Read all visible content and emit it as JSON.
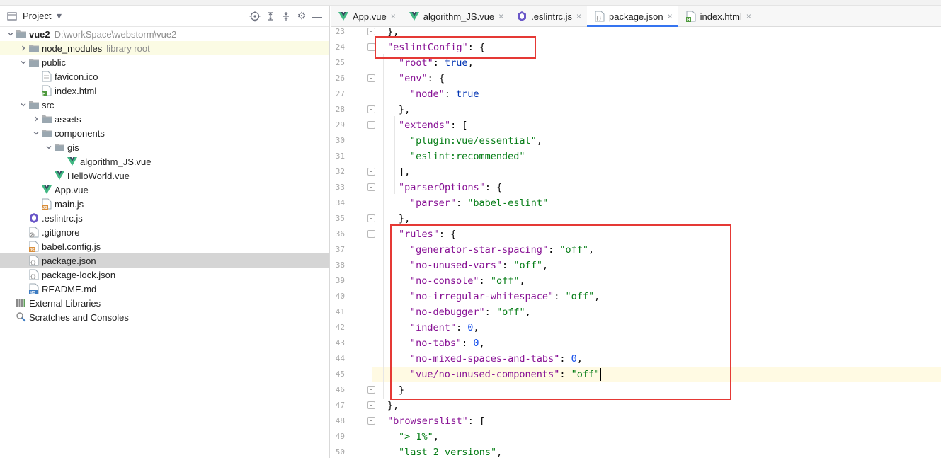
{
  "project_panel": {
    "title": "Project",
    "tree": [
      {
        "indent": 0,
        "arrow": "down",
        "icon": "folder-icon",
        "label": "vue2",
        "bold": true,
        "muted": "D:\\workSpace\\webstorm\\vue2"
      },
      {
        "indent": 1,
        "arrow": "right",
        "icon": "folder-icon",
        "label": "node_modules",
        "muted": "library root",
        "hl": true
      },
      {
        "indent": 1,
        "arrow": "down",
        "icon": "folder-icon",
        "label": "public"
      },
      {
        "indent": 2,
        "arrow": "",
        "icon": "ico-file-icon",
        "label": "favicon.ico"
      },
      {
        "indent": 2,
        "arrow": "",
        "icon": "html-file-icon",
        "label": "index.html"
      },
      {
        "indent": 1,
        "arrow": "down",
        "icon": "folder-icon",
        "label": "src"
      },
      {
        "indent": 2,
        "arrow": "right",
        "icon": "folder-icon",
        "label": "assets"
      },
      {
        "indent": 2,
        "arrow": "down",
        "icon": "folder-icon",
        "label": "components"
      },
      {
        "indent": 3,
        "arrow": "down",
        "icon": "folder-icon",
        "label": "gis"
      },
      {
        "indent": 4,
        "arrow": "",
        "icon": "vue-file-icon",
        "label": "algorithm_JS.vue"
      },
      {
        "indent": 3,
        "arrow": "",
        "icon": "vue-file-icon",
        "label": "HelloWorld.vue"
      },
      {
        "indent": 2,
        "arrow": "",
        "icon": "vue-file-icon",
        "label": "App.vue"
      },
      {
        "indent": 2,
        "arrow": "",
        "icon": "js-file-icon",
        "label": "main.js"
      },
      {
        "indent": 1,
        "arrow": "",
        "icon": "eslint-file-icon",
        "label": ".eslintrc.js"
      },
      {
        "indent": 1,
        "arrow": "",
        "icon": "gitignore-file-icon",
        "label": ".gitignore"
      },
      {
        "indent": 1,
        "arrow": "",
        "icon": "js-file-icon",
        "label": "babel.config.js"
      },
      {
        "indent": 1,
        "arrow": "",
        "icon": "json-file-icon",
        "label": "package.json",
        "selected": true
      },
      {
        "indent": 1,
        "arrow": "",
        "icon": "json-file-icon",
        "label": "package-lock.json"
      },
      {
        "indent": 1,
        "arrow": "",
        "icon": "md-file-icon",
        "label": "README.md"
      },
      {
        "indent": 0,
        "arrow": "",
        "icon": "libraries-icon",
        "label": "External Libraries"
      },
      {
        "indent": 0,
        "arrow": "",
        "icon": "scratches-icon",
        "label": "Scratches and Consoles"
      }
    ]
  },
  "tabs": [
    {
      "label": "App.vue",
      "icon": "vue-file-icon"
    },
    {
      "label": "algorithm_JS.vue",
      "icon": "vue-file-icon"
    },
    {
      "label": ".eslintrc.js",
      "icon": "eslint-file-icon"
    },
    {
      "label": "package.json",
      "icon": "json-file-icon",
      "active": true
    },
    {
      "label": "index.html",
      "icon": "html-file-icon"
    }
  ],
  "editor": {
    "current_line": 45,
    "lines": [
      {
        "n": 23,
        "ind": 1,
        "parts": [
          [
            "p",
            "},"
          ]
        ],
        "fold": true
      },
      {
        "n": 24,
        "ind": 1,
        "parts": [
          [
            "k",
            "\"eslintConfig\""
          ],
          [
            "p",
            ": {"
          ]
        ],
        "fold": true
      },
      {
        "n": 25,
        "ind": 2,
        "parts": [
          [
            "k",
            "\"root\""
          ],
          [
            "p",
            ": "
          ],
          [
            "w",
            "true"
          ],
          [
            "p",
            ","
          ]
        ]
      },
      {
        "n": 26,
        "ind": 2,
        "parts": [
          [
            "k",
            "\"env\""
          ],
          [
            "p",
            ": {"
          ]
        ],
        "fold": true
      },
      {
        "n": 27,
        "ind": 3,
        "parts": [
          [
            "k",
            "\"node\""
          ],
          [
            "p",
            ": "
          ],
          [
            "w",
            "true"
          ]
        ]
      },
      {
        "n": 28,
        "ind": 2,
        "parts": [
          [
            "p",
            "},"
          ]
        ],
        "fold": true
      },
      {
        "n": 29,
        "ind": 2,
        "parts": [
          [
            "k",
            "\"extends\""
          ],
          [
            "p",
            ": ["
          ]
        ],
        "fold": true
      },
      {
        "n": 30,
        "ind": 3,
        "parts": [
          [
            "s",
            "\"plugin:vue/essential\""
          ],
          [
            "p",
            ","
          ]
        ]
      },
      {
        "n": 31,
        "ind": 3,
        "parts": [
          [
            "s",
            "\"eslint:recommended\""
          ]
        ]
      },
      {
        "n": 32,
        "ind": 2,
        "parts": [
          [
            "p",
            "],"
          ]
        ],
        "fold": true
      },
      {
        "n": 33,
        "ind": 2,
        "parts": [
          [
            "k",
            "\"parserOptions\""
          ],
          [
            "p",
            ": {"
          ]
        ],
        "fold": true
      },
      {
        "n": 34,
        "ind": 3,
        "parts": [
          [
            "k",
            "\"parser\""
          ],
          [
            "p",
            ": "
          ],
          [
            "s",
            "\"babel-eslint\""
          ]
        ]
      },
      {
        "n": 35,
        "ind": 2,
        "parts": [
          [
            "p",
            "},"
          ]
        ],
        "fold": true
      },
      {
        "n": 36,
        "ind": 2,
        "parts": [
          [
            "k",
            "\"rules\""
          ],
          [
            "p",
            ": {"
          ]
        ],
        "fold": true
      },
      {
        "n": 37,
        "ind": 3,
        "parts": [
          [
            "k",
            "\"generator-star-spacing\""
          ],
          [
            "p",
            ": "
          ],
          [
            "s",
            "\"off\""
          ],
          [
            "p",
            ","
          ]
        ]
      },
      {
        "n": 38,
        "ind": 3,
        "parts": [
          [
            "k",
            "\"no-unused-vars\""
          ],
          [
            "p",
            ": "
          ],
          [
            "s",
            "\"off\""
          ],
          [
            "p",
            ","
          ]
        ]
      },
      {
        "n": 39,
        "ind": 3,
        "parts": [
          [
            "k",
            "\"no-console\""
          ],
          [
            "p",
            ": "
          ],
          [
            "s",
            "\"off\""
          ],
          [
            "p",
            ","
          ]
        ]
      },
      {
        "n": 40,
        "ind": 3,
        "parts": [
          [
            "k",
            "\"no-irregular-whitespace\""
          ],
          [
            "p",
            ": "
          ],
          [
            "s",
            "\"off\""
          ],
          [
            "p",
            ","
          ]
        ]
      },
      {
        "n": 41,
        "ind": 3,
        "parts": [
          [
            "k",
            "\"no-debugger\""
          ],
          [
            "p",
            ": "
          ],
          [
            "s",
            "\"off\""
          ],
          [
            "p",
            ","
          ]
        ]
      },
      {
        "n": 42,
        "ind": 3,
        "parts": [
          [
            "k",
            "\"indent\""
          ],
          [
            "p",
            ": "
          ],
          [
            "n",
            "0"
          ],
          [
            "p",
            ","
          ]
        ]
      },
      {
        "n": 43,
        "ind": 3,
        "parts": [
          [
            "k",
            "\"no-tabs\""
          ],
          [
            "p",
            ": "
          ],
          [
            "n",
            "0"
          ],
          [
            "p",
            ","
          ]
        ]
      },
      {
        "n": 44,
        "ind": 3,
        "parts": [
          [
            "k",
            "\"no-mixed-spaces-and-tabs\""
          ],
          [
            "p",
            ": "
          ],
          [
            "n",
            "0"
          ],
          [
            "p",
            ","
          ]
        ]
      },
      {
        "n": 45,
        "ind": 3,
        "parts": [
          [
            "k",
            "\"vue/no-unused-components\""
          ],
          [
            "p",
            ": "
          ],
          [
            "s",
            "\"off\""
          ]
        ],
        "caret": true
      },
      {
        "n": 46,
        "ind": 2,
        "parts": [
          [
            "p",
            "}"
          ]
        ],
        "fold": true
      },
      {
        "n": 47,
        "ind": 1,
        "parts": [
          [
            "p",
            "},"
          ]
        ],
        "fold": true
      },
      {
        "n": 48,
        "ind": 1,
        "parts": [
          [
            "k",
            "\"browserslist\""
          ],
          [
            "p",
            ": ["
          ]
        ],
        "fold": true
      },
      {
        "n": 49,
        "ind": 2,
        "parts": [
          [
            "s",
            "\"> 1%\""
          ],
          [
            "p",
            ","
          ]
        ]
      },
      {
        "n": 50,
        "ind": 2,
        "parts": [
          [
            "s",
            "\"last 2 versions\""
          ],
          [
            "p",
            ","
          ]
        ]
      }
    ]
  },
  "colors": {
    "highlight_box": "#e53935",
    "active_tab_underline": "#3574f0",
    "vue_green": "#41b883"
  }
}
